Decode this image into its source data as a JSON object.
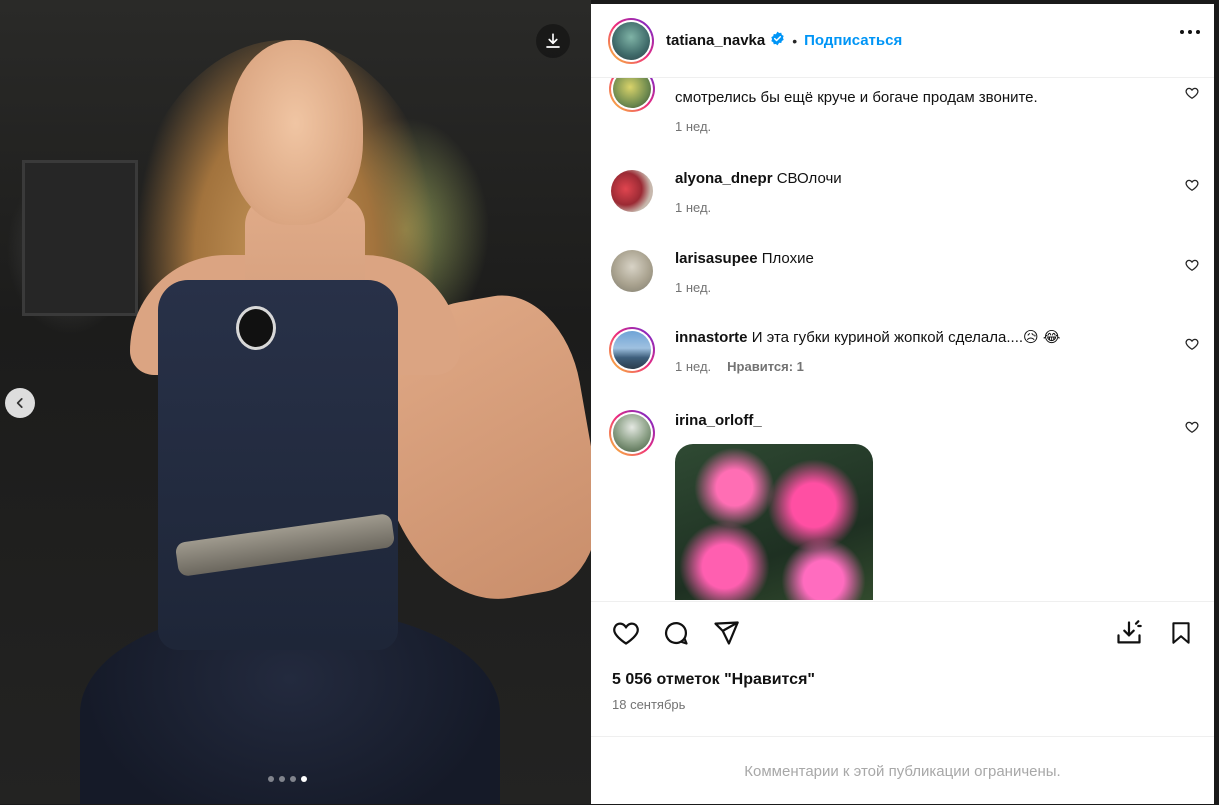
{
  "post": {
    "username": "tatiana_navka",
    "separator": "•",
    "follow_label": "Подписаться",
    "likes_text": "5 056 отметок \"Нравится\"",
    "date": "18 сентябрь",
    "comments_limited": "Комментарии к этой публикации ограничены.",
    "carousel": {
      "total": 4,
      "current": 4
    }
  },
  "comments": [
    {
      "username": "",
      "text": "смотрелись бы ещё круче и богаче продам звоните.",
      "time": "1 нед.",
      "likes": "",
      "partial_top": true
    },
    {
      "username": "alyona_dnepr",
      "text": "СВОлочи",
      "time": "1 нед.",
      "likes": ""
    },
    {
      "username": "larisasupee",
      "text": "Плохие",
      "time": "1 нед.",
      "likes": ""
    },
    {
      "username": "innastorte",
      "text": "И эта губки куриной жопкой сделала....😥 😂",
      "time": "1 нед.",
      "likes": "Нравится: 1"
    },
    {
      "username": "irina_orloff_",
      "text": "",
      "time": "",
      "likes": "",
      "has_image": true
    }
  ],
  "icons": {
    "download": "download-icon",
    "prev": "chevron-left-icon",
    "verified": "verified-badge-icon",
    "more": "more-horizontal-icon",
    "like": "heart-icon",
    "comment": "comment-icon",
    "share": "send-icon",
    "save_download": "save-download-icon",
    "bookmark": "bookmark-icon"
  },
  "colors": {
    "accent": "#0095f6",
    "secondary_text": "#737373",
    "muted_text": "#a8a8a8"
  }
}
